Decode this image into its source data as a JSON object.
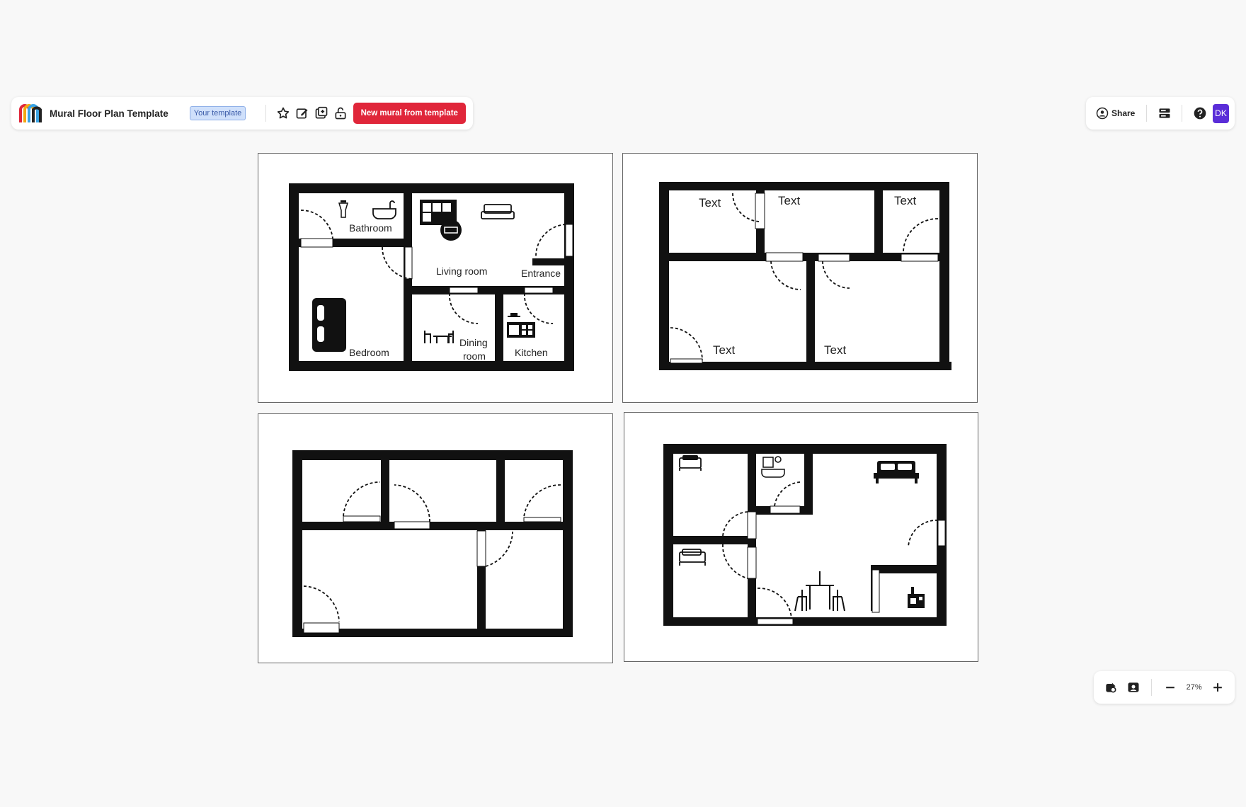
{
  "header": {
    "title": "Mural Floor Plan Template",
    "badge": "Your template",
    "new_mural_button": "New mural from template",
    "share_label": "Share",
    "avatar_initials": "DK",
    "accent_color": "#e0263a",
    "avatar_color": "#5a2dd8"
  },
  "zoom": {
    "level": "27%"
  },
  "floor_plans": {
    "plan1": {
      "bathroom": "Bathroom",
      "living_room": "Living room",
      "entrance": "Entrance",
      "bedroom": "Bedroom",
      "dining_line1": "Dining",
      "dining_line2": "room",
      "kitchen": "Kitchen"
    },
    "plan2": {
      "text1": "Text",
      "text2": "Text",
      "text3": "Text",
      "text4": "Text",
      "text5": "Text"
    }
  },
  "icons": [
    "mural-logo-icon",
    "star-icon",
    "edit-icon",
    "duplicate-icon",
    "lock-icon",
    "share-user-icon",
    "outline-icon",
    "help-icon",
    "hand-icon",
    "follow-icon",
    "minus-icon",
    "plus-icon"
  ]
}
